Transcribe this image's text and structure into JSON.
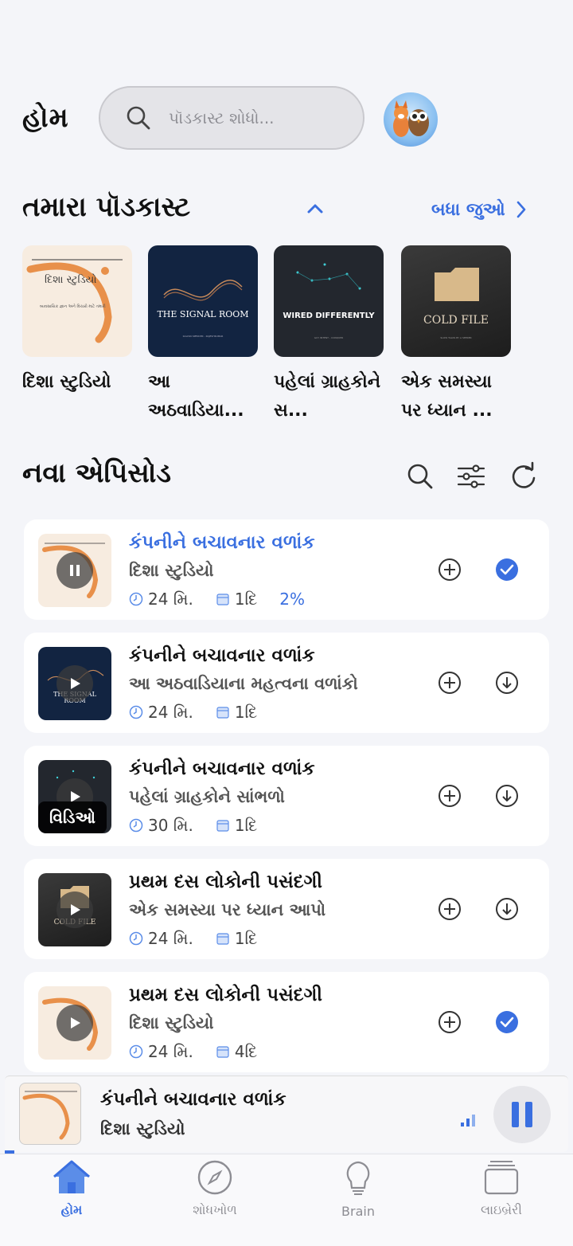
{
  "header": {
    "title": "હોમ",
    "search_placeholder": "પૉડકાસ્ટ શોધો..."
  },
  "podcasts_section": {
    "title": "તમારા પૉડકાસ્ટ",
    "see_all": "બધા જુઓ",
    "items": [
      {
        "name": "દિશા સ્ટુડિયો",
        "cover_title": "દિશા સ્ટુડિયો",
        "cover_sub": "વ્યવસાયિક જ્ઞાન અને વિચારો માટે તમારી"
      },
      {
        "name": "આ અઠવાડિયા...",
        "cover_title": "THE SIGNAL ROOM",
        "cover_sub": "KALYAN SPENCER - RAJESHKUMAR"
      },
      {
        "name": "પહેલાં ગ્રાહકોને સ...",
        "cover_title": "WIRED DIFFERENTLY",
        "cover_sub": "GUY INTENT - CONQUER"
      },
      {
        "name": "એક સમસ્યા પર ધ્યાન ...",
        "cover_title": "COLD FILE",
        "cover_sub": "SLOW TALKS BY A SEEKER"
      }
    ]
  },
  "episodes_section": {
    "title": "નવા એપિસોડ",
    "items": [
      {
        "title": "કંપનીને બચાવનાર વળાંક",
        "show": "દિશા સ્ટુડિયો",
        "duration": "24 મિ.",
        "age": "1દિ",
        "progress": "2%",
        "state": "playing",
        "done": true
      },
      {
        "title": "કંપનીને બચાવનાર વળાંક",
        "show": "આ અઠવાડિયાના મહત્વના વળાંકો",
        "duration": "24 મિ.",
        "age": "1દિ",
        "progress": "",
        "state": "paused",
        "done": false
      },
      {
        "title": "કંપનીને બચાવનાર વળાંક",
        "show": "પહેલાં ગ્રાહકોને સાંભળો",
        "duration": "30 મિ.",
        "age": "1દિ",
        "progress": "",
        "state": "video",
        "badge": "વિડિઓ",
        "done": false
      },
      {
        "title": "પ્રથમ દસ લોકોની પસંદગી",
        "show": "એક સમસ્યા પર ધ્યાન આપો",
        "duration": "24 મિ.",
        "age": "1દિ",
        "progress": "",
        "state": "paused",
        "done": false
      },
      {
        "title": "પ્રથમ દસ લોકોની પસંદગી",
        "show": "દિશા સ્ટુડિયો",
        "duration": "24 મિ.",
        "age": "4દિ",
        "progress": "",
        "state": "paused",
        "done": true
      }
    ]
  },
  "mini_player": {
    "title": "કંપનીને બચાવનાર વળાંક",
    "show": "દિશા સ્ટુડિયો"
  },
  "tabs": [
    {
      "label": "હોમ",
      "icon": "home-icon",
      "active": true
    },
    {
      "label": "શોધખોળ",
      "icon": "compass-icon",
      "active": false
    },
    {
      "label": "Brain",
      "icon": "lightbulb-icon",
      "active": false
    },
    {
      "label": "લાઇબ્રેરી",
      "icon": "library-icon",
      "active": false
    }
  ],
  "colors": {
    "accent": "#3a6fe0",
    "background": "#f4f5f9",
    "card": "#ffffff"
  }
}
